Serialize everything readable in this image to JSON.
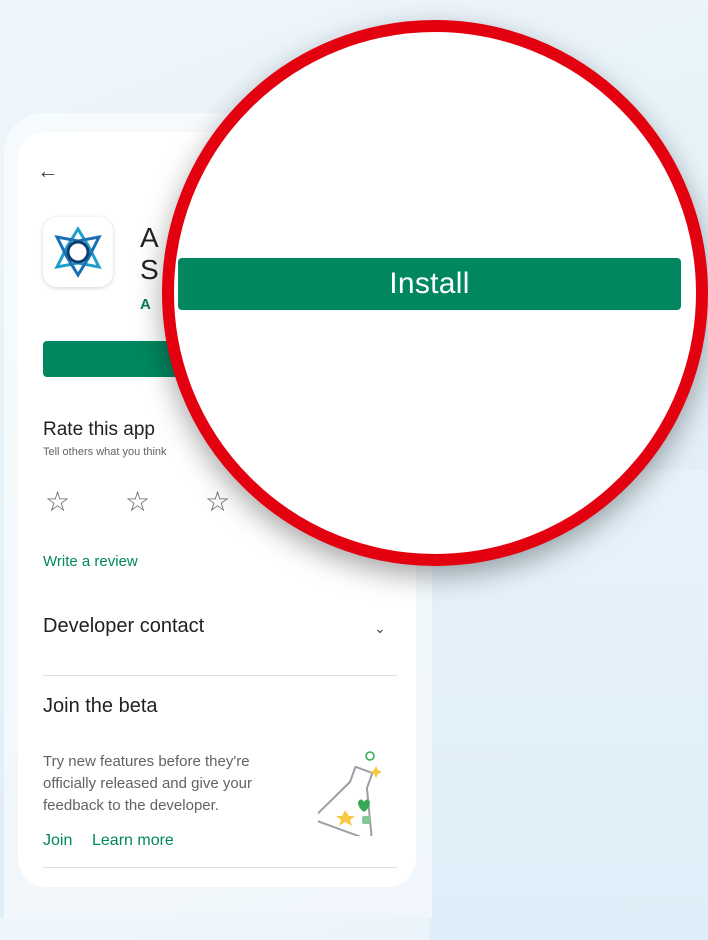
{
  "app": {
    "title_visible": "A\nS",
    "developer_visible": "A"
  },
  "rate": {
    "title": "Rate this app",
    "subtitle": "Tell others what you think",
    "stars": [
      "☆",
      "☆",
      "☆"
    ],
    "write_review": "Write a review"
  },
  "developer_contact": {
    "label": "Developer contact",
    "chevron": "⌄"
  },
  "beta": {
    "title": "Join the beta",
    "description": "Try new features before they're officially released and give your feedback to the developer.",
    "join": "Join",
    "learn_more": "Learn more"
  },
  "install": {
    "label": "Install"
  },
  "nav": {
    "back": "←"
  },
  "colors": {
    "accent_green": "#01875f",
    "highlight_red": "#e3000f"
  },
  "icons": {
    "back": "arrow-left-icon",
    "app": "app-logo-icon",
    "star": "star-outline-icon",
    "chevron": "chevron-down-icon",
    "beta_flask": "flask-illustration-icon"
  }
}
